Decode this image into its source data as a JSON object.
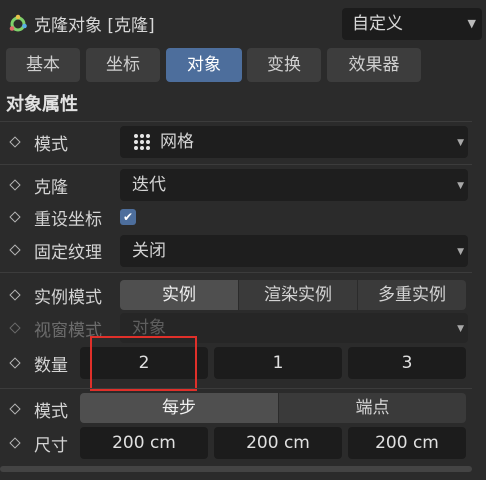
{
  "header": {
    "title": "克隆对象 [克隆]",
    "preset": "自定义",
    "title_icon": "cloner-gear-icon"
  },
  "tabs": [
    {
      "label": "基本",
      "active": false
    },
    {
      "label": "坐标",
      "active": false
    },
    {
      "label": "对象",
      "active": true
    },
    {
      "label": "变换",
      "active": false
    },
    {
      "label": "效果器",
      "active": false
    }
  ],
  "section_title": "对象属性",
  "props": {
    "mode": {
      "label": "模式",
      "value": "网格",
      "icon": "grid-dots-icon"
    },
    "clone": {
      "label": "克隆",
      "value": "迭代"
    },
    "reset_coords": {
      "label": "重设坐标",
      "checked": true
    },
    "fix_texture": {
      "label": "固定纹理",
      "value": "关闭"
    },
    "instance_mode": {
      "label": "实例模式",
      "options": [
        "实例",
        "渲染实例",
        "多重实例"
      ],
      "selected": "实例"
    },
    "viewport_mode": {
      "label": "视窗模式",
      "value": "对象",
      "enabled": false
    },
    "count": {
      "label": "数量",
      "values": [
        "2",
        "1",
        "3"
      ]
    },
    "size_mode": {
      "label": "模式",
      "options": [
        "每步",
        "端点"
      ],
      "selected": "每步"
    },
    "size": {
      "label": "尺寸",
      "values": [
        "200 cm",
        "200 cm",
        "200 cm"
      ]
    }
  },
  "colors": {
    "accent": "#4d6e9c",
    "highlight": "#e0302a",
    "background": "#2b2b2b"
  }
}
